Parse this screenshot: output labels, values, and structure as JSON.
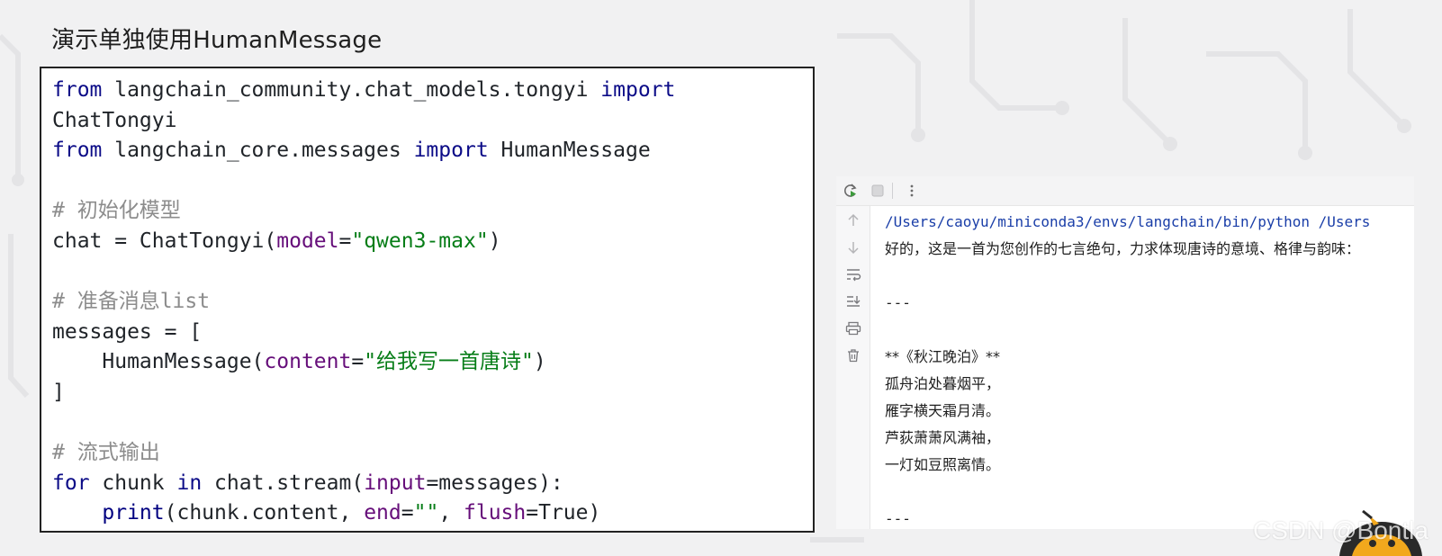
{
  "slide": {
    "title": "演示单独使用HumanMessage"
  },
  "code": {
    "lines": [
      [
        {
          "t": "from",
          "c": "kw"
        },
        {
          "t": " langchain_community.chat_models.tongyi ",
          "c": ""
        },
        {
          "t": "import",
          "c": "kw"
        }
      ],
      [
        {
          "t": "ChatTongyi",
          "c": ""
        }
      ],
      [
        {
          "t": "from",
          "c": "kw"
        },
        {
          "t": " langchain_core.messages ",
          "c": ""
        },
        {
          "t": "import",
          "c": "kw"
        },
        {
          "t": " HumanMessage",
          "c": ""
        }
      ],
      [],
      [
        {
          "t": "# 初始化模型",
          "c": "cm"
        }
      ],
      [
        {
          "t": "chat = ChatTongyi(",
          "c": ""
        },
        {
          "t": "model",
          "c": "pa"
        },
        {
          "t": "=",
          "c": ""
        },
        {
          "t": "\"qwen3-max\"",
          "c": "st"
        },
        {
          "t": ")",
          "c": ""
        }
      ],
      [],
      [
        {
          "t": "# 准备消息list",
          "c": "cm"
        }
      ],
      [
        {
          "t": "messages = [",
          "c": ""
        }
      ],
      [
        {
          "t": "    HumanMessage(",
          "c": ""
        },
        {
          "t": "content",
          "c": "pa"
        },
        {
          "t": "=",
          "c": ""
        },
        {
          "t": "\"给我写一首唐诗\"",
          "c": "st"
        },
        {
          "t": ")",
          "c": ""
        }
      ],
      [
        {
          "t": "]",
          "c": ""
        }
      ],
      [],
      [
        {
          "t": "# 流式输出",
          "c": "cm"
        }
      ],
      [
        {
          "t": "for",
          "c": "kw"
        },
        {
          "t": " chunk ",
          "c": ""
        },
        {
          "t": "in",
          "c": "kw"
        },
        {
          "t": " chat.stream(",
          "c": ""
        },
        {
          "t": "input",
          "c": "pa"
        },
        {
          "t": "=messages):",
          "c": ""
        }
      ],
      [
        {
          "t": "    ",
          "c": ""
        },
        {
          "t": "print",
          "c": "bi"
        },
        {
          "t": "(chunk.content, ",
          "c": ""
        },
        {
          "t": "end",
          "c": "pa"
        },
        {
          "t": "=",
          "c": ""
        },
        {
          "t": "\"\"",
          "c": "st"
        },
        {
          "t": ", ",
          "c": ""
        },
        {
          "t": "flush",
          "c": "pa"
        },
        {
          "t": "=True)",
          "c": ""
        }
      ]
    ]
  },
  "run": {
    "toolbar_icons": [
      "rerun-icon",
      "stop-icon",
      "more-options-icon"
    ],
    "gutter_icons": [
      "scroll-up-icon",
      "scroll-down-icon",
      "soft-wrap-icon",
      "scroll-to-end-icon",
      "print-icon",
      "trash-icon"
    ],
    "output": [
      {
        "text": "/Users/caoyu/miniconda3/envs/langchain/bin/python /Users",
        "kind": "path"
      },
      {
        "text": "好的，这是一首为您创作的七言绝句，力求体现唐诗的意境、格律与韵味：",
        "kind": ""
      },
      {
        "text": "",
        "kind": ""
      },
      {
        "text": "---",
        "kind": "mono"
      },
      {
        "text": "",
        "kind": ""
      },
      {
        "text": "**《秋江晚泊》**",
        "kind": ""
      },
      {
        "text": "孤舟泊处暮烟平，",
        "kind": ""
      },
      {
        "text": "雁字横天霜月清。",
        "kind": ""
      },
      {
        "text": "芦荻萧萧风满袖，",
        "kind": ""
      },
      {
        "text": "一灯如豆照离情。",
        "kind": ""
      },
      {
        "text": "",
        "kind": ""
      },
      {
        "text": "---",
        "kind": "mono"
      }
    ]
  },
  "watermark": "CSDN @Bontla",
  "colors": {
    "keyword": "#0b0b87",
    "comment": "#8c8c8c",
    "string": "#067d17",
    "param": "#660e7a",
    "path": "#1a3ea8"
  }
}
